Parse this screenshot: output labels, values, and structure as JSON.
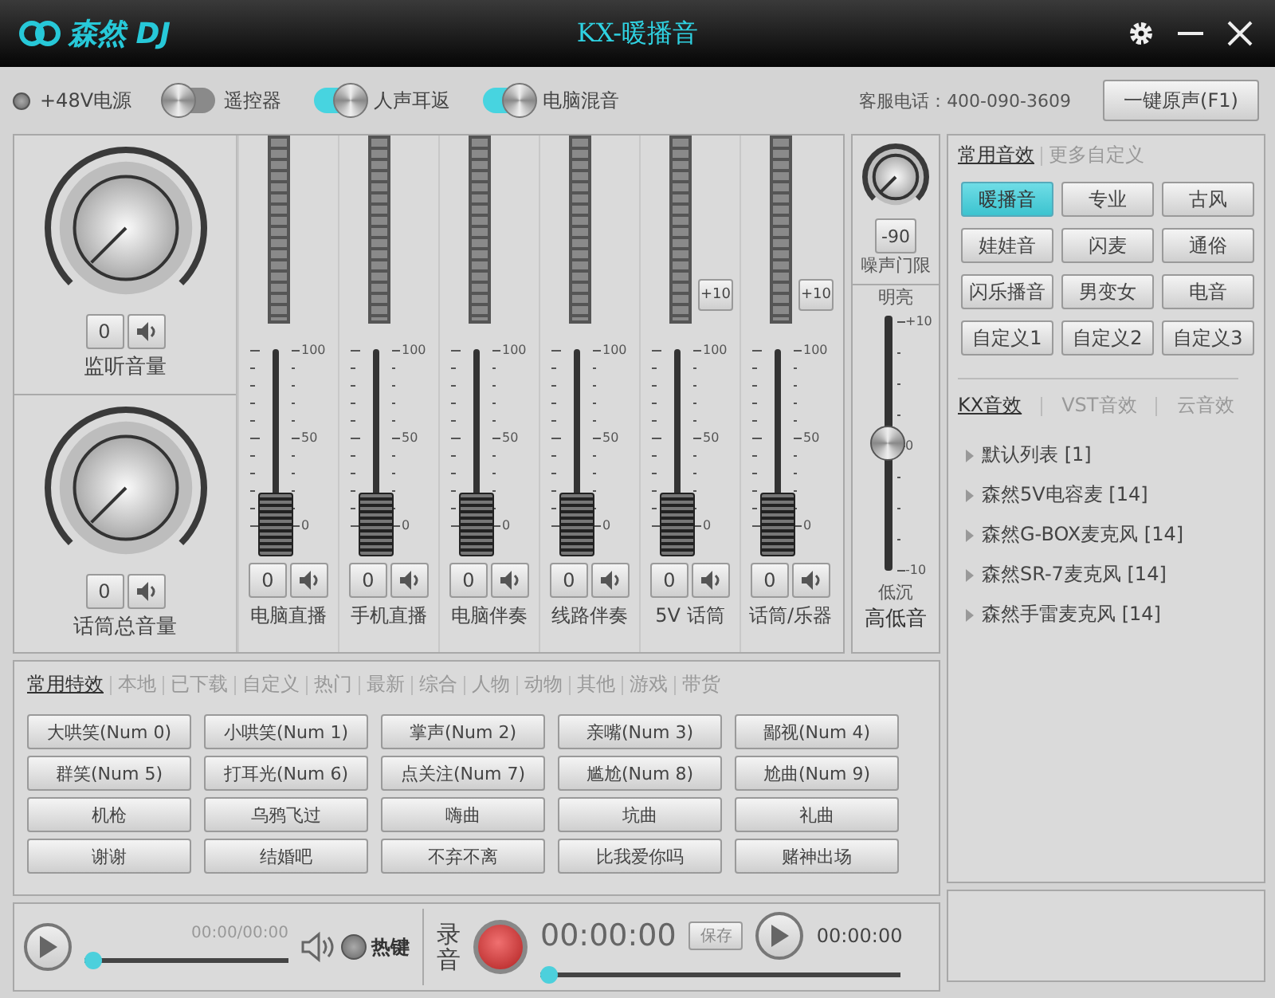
{
  "window": {
    "logo": "森然 DJ",
    "title": "KX-暖播音"
  },
  "toolbar": {
    "switches": [
      {
        "kind": "radio",
        "label": "+48V电源",
        "on": false
      },
      {
        "kind": "toggle",
        "label": "遥控器",
        "on": false
      },
      {
        "kind": "toggle",
        "label": "人声耳返",
        "on": true
      },
      {
        "kind": "toggle",
        "label": "电脑混音",
        "on": true
      }
    ],
    "hotline": "客服电话：400-090-3609",
    "reset_button": "一键原声(F1)"
  },
  "knobs": [
    {
      "label": "监听音量",
      "value": "0"
    },
    {
      "label": "话筒总音量",
      "value": "0"
    }
  ],
  "channels": [
    {
      "name": "电脑直播",
      "value": "0",
      "level": 0,
      "scale": [
        "100",
        "50",
        "0"
      ]
    },
    {
      "name": "手机直播",
      "value": "0",
      "level": 0,
      "scale": [
        "100",
        "50",
        "0"
      ]
    },
    {
      "name": "电脑伴奏",
      "value": "0",
      "level": 0,
      "scale": [
        "100",
        "50",
        "0"
      ]
    },
    {
      "name": "线路伴奏",
      "value": "0",
      "level": 0,
      "scale": [
        "100",
        "50",
        "0"
      ]
    },
    {
      "name": "5V 话筒",
      "value": "0",
      "level": 0,
      "boost": "+10",
      "scale": [
        "100",
        "50",
        "0"
      ]
    },
    {
      "name": "话筒/乐器",
      "value": "0",
      "level": 0,
      "boost": "+10",
      "scale": [
        "100",
        "50",
        "0"
      ]
    }
  ],
  "eq": {
    "gate_value": "-90",
    "gate_label": "噪声门限",
    "top_label": "明亮",
    "bottom_label": "低沉",
    "scale": [
      "+10",
      "0",
      "-10"
    ],
    "level": 0.5,
    "label": "高低音"
  },
  "effects_panel": {
    "tabs": [
      {
        "label": "常用音效",
        "selected": true
      },
      {
        "label": "更多自定义",
        "selected": false
      }
    ],
    "presets": [
      {
        "label": "暖播音",
        "selected": true
      },
      {
        "label": "专业",
        "selected": false
      },
      {
        "label": "古风",
        "selected": false
      },
      {
        "label": "娃娃音",
        "selected": false
      },
      {
        "label": "闪麦",
        "selected": false
      },
      {
        "label": "通俗",
        "selected": false
      },
      {
        "label": "闪乐播音",
        "selected": false
      },
      {
        "label": "男变女",
        "selected": false
      },
      {
        "label": "电音",
        "selected": false
      },
      {
        "label": "自定义1",
        "selected": false
      },
      {
        "label": "自定义2",
        "selected": false
      },
      {
        "label": "自定义3",
        "selected": false
      }
    ],
    "source_tabs": [
      {
        "label": "KX音效",
        "selected": true
      },
      {
        "label": "VST音效",
        "selected": false
      },
      {
        "label": "云音效",
        "selected": false
      }
    ],
    "lists": [
      {
        "label": "默认列表 [1]",
        "expanded": false
      },
      {
        "label": "森然5V电容麦 [14]",
        "expanded": false
      },
      {
        "label": "森然G-BOX麦克风 [14]",
        "expanded": false
      },
      {
        "label": "森然SR-7麦克风 [14]",
        "expanded": false
      },
      {
        "label": "森然手雷麦克风 [14]",
        "expanded": false
      }
    ]
  },
  "sound_fx": {
    "tabs": [
      {
        "label": "常用特效",
        "selected": true
      },
      {
        "label": "本地",
        "selected": false
      },
      {
        "label": "已下载",
        "selected": false
      },
      {
        "label": "自定义",
        "selected": false
      },
      {
        "label": "热门",
        "selected": false
      },
      {
        "label": "最新",
        "selected": false
      },
      {
        "label": "综合",
        "selected": false
      },
      {
        "label": "人物",
        "selected": false
      },
      {
        "label": "动物",
        "selected": false
      },
      {
        "label": "其他",
        "selected": false
      },
      {
        "label": "游戏",
        "selected": false
      },
      {
        "label": "带货",
        "selected": false
      }
    ],
    "buttons": [
      "大哄笑(Num 0)",
      "小哄笑(Num 1)",
      "掌声(Num 2)",
      "亲嘴(Num 3)",
      "鄙视(Num 4)",
      "群笑(Num 5)",
      "打耳光(Num 6)",
      "点关注(Num 7)",
      "尴尬(Num 8)",
      "尬曲(Num 9)",
      "机枪",
      "乌鸦飞过",
      "嗨曲",
      "坑曲",
      "礼曲",
      "谢谢",
      "结婚吧",
      "不弃不离",
      "比我爱你吗",
      "赌神出场"
    ]
  },
  "player": {
    "time": "00:00/00:00",
    "level": 0,
    "hotkey_label": "热键",
    "hotkey_on": false
  },
  "recorder": {
    "label": "录音",
    "time": "00:00:00",
    "save_button": "保存",
    "play_time": "00:00:00",
    "level": 0
  }
}
